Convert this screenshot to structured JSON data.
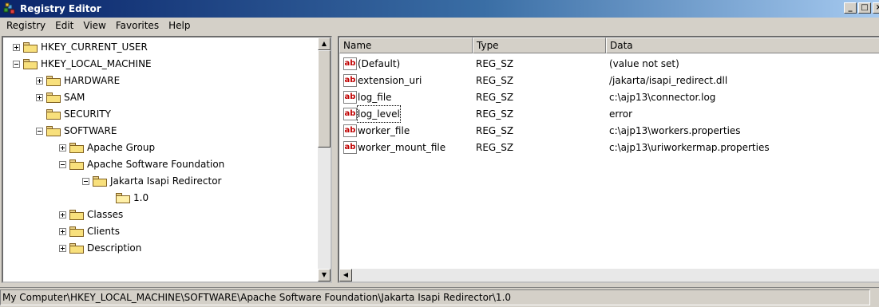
{
  "window": {
    "title": "Registry Editor",
    "minimize": "_",
    "maximize": "□",
    "close": "×"
  },
  "menu": [
    "Registry",
    "Edit",
    "View",
    "Favorites",
    "Help"
  ],
  "tree": [
    {
      "label": "HKEY_CURRENT_USER",
      "indent": 0,
      "expander": "plus",
      "open": false
    },
    {
      "label": "HKEY_LOCAL_MACHINE",
      "indent": 0,
      "expander": "minus",
      "open": false
    },
    {
      "label": "HARDWARE",
      "indent": 1,
      "expander": "plus",
      "open": false
    },
    {
      "label": "SAM",
      "indent": 1,
      "expander": "plus",
      "open": false
    },
    {
      "label": "SECURITY",
      "indent": 1,
      "expander": "none",
      "open": false
    },
    {
      "label": "SOFTWARE",
      "indent": 1,
      "expander": "minus",
      "open": false
    },
    {
      "label": "Apache Group",
      "indent": 2,
      "expander": "plus",
      "open": false
    },
    {
      "label": "Apache Software Foundation",
      "indent": 2,
      "expander": "minus",
      "open": false
    },
    {
      "label": "Jakarta Isapi Redirector",
      "indent": 3,
      "expander": "minus",
      "open": false
    },
    {
      "label": "1.0",
      "indent": 4,
      "expander": "none",
      "open": true
    },
    {
      "label": "Classes",
      "indent": 2,
      "expander": "plus",
      "open": false
    },
    {
      "label": "Clients",
      "indent": 2,
      "expander": "plus",
      "open": false
    },
    {
      "label": "Description",
      "indent": 2,
      "expander": "plus",
      "open": false
    }
  ],
  "columns": {
    "name": "Name",
    "type": "Type",
    "data": "Data"
  },
  "values": [
    {
      "name": "(Default)",
      "type": "REG_SZ",
      "data": "(value not set)"
    },
    {
      "name": "extension_uri",
      "type": "REG_SZ",
      "data": "/jakarta/isapi_redirect.dll"
    },
    {
      "name": "log_file",
      "type": "REG_SZ",
      "data": "c:\\ajp13\\connector.log"
    },
    {
      "name": "log_level",
      "type": "REG_SZ",
      "data": "error"
    },
    {
      "name": "worker_file",
      "type": "REG_SZ",
      "data": "c:\\ajp13\\workers.properties"
    },
    {
      "name": "worker_mount_file",
      "type": "REG_SZ",
      "data": "c:\\ajp13\\uriworkermap.properties"
    }
  ],
  "value_icon": "ab",
  "status": "My Computer\\HKEY_LOCAL_MACHINE\\SOFTWARE\\Apache Software Foundation\\Jakarta Isapi Redirector\\1.0"
}
